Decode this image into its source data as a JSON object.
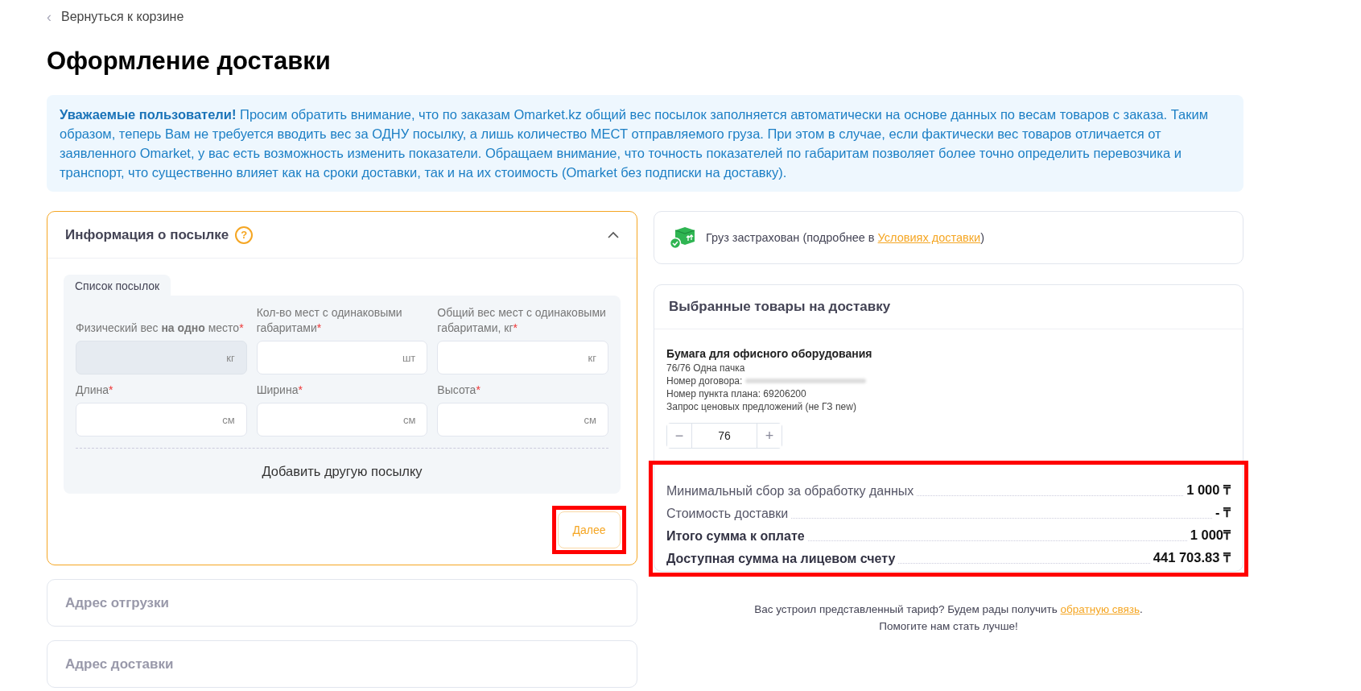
{
  "back_link": {
    "icon": "‹",
    "label": "Вернуться к корзине"
  },
  "title": "Оформление доставки",
  "notice": "**Уважаемые пользователи!** Просим обратить внимание, что по заказам Omarket.kz общий вес посылок заполняется автоматически на основе данных по весам товаров с заказа. Таким образом, теперь Вам не требуется вводить вес за ОДНУ посылку, а лишь количество МЕСТ отправляемого груза. При этом в случае, если фактически вес товаров отличается от заявленного Omarket, у вас есть возможность изменить показатели. Обращаем внимание, что точность показателей по габаритам позволяет более точно определить перевозчика и транспорт, что существенно влияет как на сроки доставки, так и на их стоимость (Omarket без подписки на доставку).",
  "sections": [
    {
      "title": "Информация о посылке",
      "help_icon": "?",
      "expanded": true,
      "tab": "Список посылок",
      "fields": [
        {
          "label": "Физический вес **на одно** место",
          "required_mark": "*",
          "unit": "кг",
          "disabled": true
        },
        {
          "label": "Кол-во мест с одинаковыми габаритами",
          "required_mark": "*",
          "unit": "шт",
          "disabled": false
        },
        {
          "label": "Общий вес мест с одинаковыми габаритами, кг",
          "required_mark": "*",
          "unit": "кг",
          "disabled": false
        },
        {
          "label": "Длина",
          "required_mark": "*",
          "unit": "см",
          "disabled": false
        },
        {
          "label": "Ширина",
          "required_mark": "*",
          "unit": "см",
          "disabled": false
        },
        {
          "label": "Высота",
          "required_mark": "*",
          "unit": "см",
          "disabled": false
        }
      ],
      "add_button": "Добавить другую посылку",
      "next_button": {
        "label": "Далее",
        "highlighted": true
      }
    },
    {
      "title": "Адрес отгрузки",
      "expanded": false
    },
    {
      "title": "Адрес доставки",
      "expanded": false
    }
  ],
  "insurance": {
    "text": "Груз застрахован (подробнее в ",
    "link": "Условиях доставки",
    "text_end": ")"
  },
  "products": {
    "title": "Выбранные товары на доставку",
    "items": [
      {
        "name": "Бумага для офисного оборудования",
        "lines": [
          {
            "text": "76/76 Одна пачка"
          },
          {
            "text": "Номер договора:",
            "redacted": true
          },
          {
            "text": "Номер пункта плана: 69206200"
          },
          {
            "text": "Запрос ценовых предложений (не ГЗ new)"
          }
        ],
        "minus": "−",
        "quantity": "76",
        "plus": "+"
      }
    ],
    "totals_highlighted": true,
    "totals": [
      {
        "label": "Минимальный сбор за обработку данных",
        "value": "1 000 ₸",
        "bold": false
      },
      {
        "label": "Стоимость доставки",
        "value": "- ₸",
        "bold": false
      },
      {
        "label": "Итого сумма к оплате",
        "value": "1 000₸",
        "bold": true
      },
      {
        "label": "Доступная сумма на лицевом счету",
        "value": "441 703.83 ₸",
        "bold": true
      }
    ]
  },
  "feedback": {
    "text": "Вас устроил представленный тариф? Будем рады получить ",
    "link": "обратную связь",
    "text_end": ".",
    "line2": "Помогите нам стать лучше!"
  }
}
